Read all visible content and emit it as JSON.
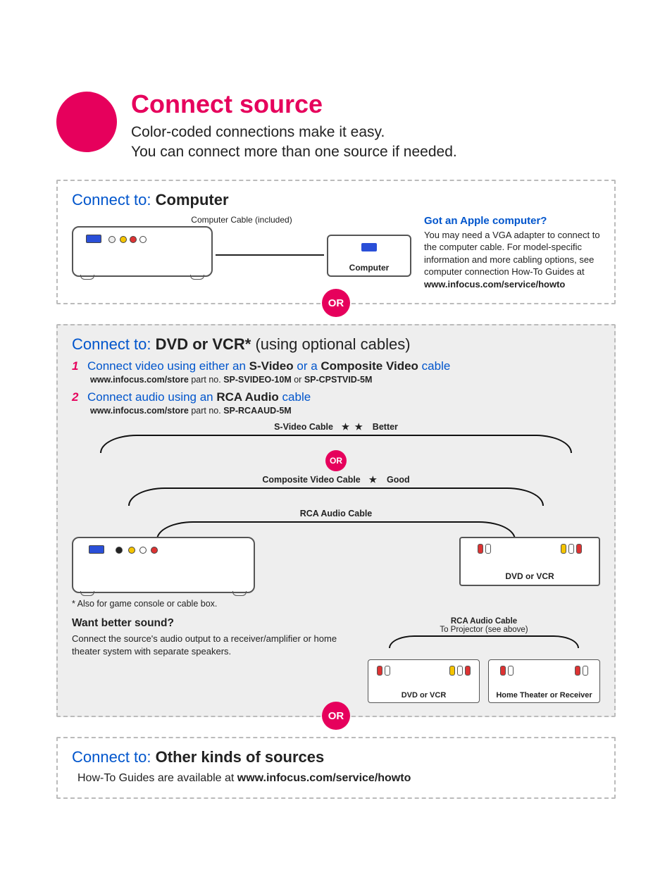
{
  "header": {
    "title": "Connect source",
    "subtitle_line1": "Color-coded connections make it easy.",
    "subtitle_line2": "You can connect more than one source if needed."
  },
  "or_label": "OR",
  "section_computer": {
    "heading_prefix": "Connect to: ",
    "heading_bold": "Computer",
    "diagram": {
      "cable_label": "Computer Cable (included)",
      "computer_label": "Computer"
    },
    "apple": {
      "title": "Got an Apple computer?",
      "body": "You may need a VGA adapter to connect to the computer cable. For model-specific information and more cabling options, see computer connection How-To Guides at",
      "url": "www.infocus.com/service/howto"
    }
  },
  "section_dvd": {
    "heading_prefix": "Connect to: ",
    "heading_bold": "DVD or VCR*",
    "heading_note": " (using optional cables)",
    "step1": {
      "num": "1",
      "text_a": "Connect video using either an ",
      "opt1": "S-Video",
      "text_b": " or a ",
      "opt2": "Composite Video",
      "text_c": " cable",
      "url": "www.infocus.com/store",
      "part_prefix": " part no.  ",
      "part1": "SP-SVIDEO-10M",
      "or_word": " or ",
      "part2": "SP-CPSTVID-5M"
    },
    "step2": {
      "num": "2",
      "text_a": "Connect audio using an ",
      "opt1": "RCA Audio",
      "text_b": " cable",
      "url": "www.infocus.com/store",
      "part_prefix": " part no.  ",
      "part1": "SP-RCAAUD-5M"
    },
    "cables": {
      "svideo": "S-Video Cable",
      "svideo_rating": "★ ★",
      "svideo_word": "Better",
      "composite": "Composite Video Cable",
      "composite_rating": "★",
      "composite_word": "Good",
      "rca": "RCA Audio Cable",
      "dvd_label": "DVD or VCR"
    },
    "footnote": "* Also for game console or cable box.",
    "sound": {
      "title": "Want better sound?",
      "body": "Connect the source's audio output to a receiver/amplifier or home theater system with separate speakers.",
      "rca_label": "RCA Audio Cable",
      "to_proj": "To Projector (see above)",
      "dvd_label": "DVD or VCR",
      "receiver_label": "Home Theater or Receiver"
    }
  },
  "section_other": {
    "heading_prefix": "Connect to: ",
    "heading_bold": "Other kinds of sources",
    "body_prefix": "How-To Guides are available at ",
    "url": "www.infocus.com/service/howto"
  }
}
